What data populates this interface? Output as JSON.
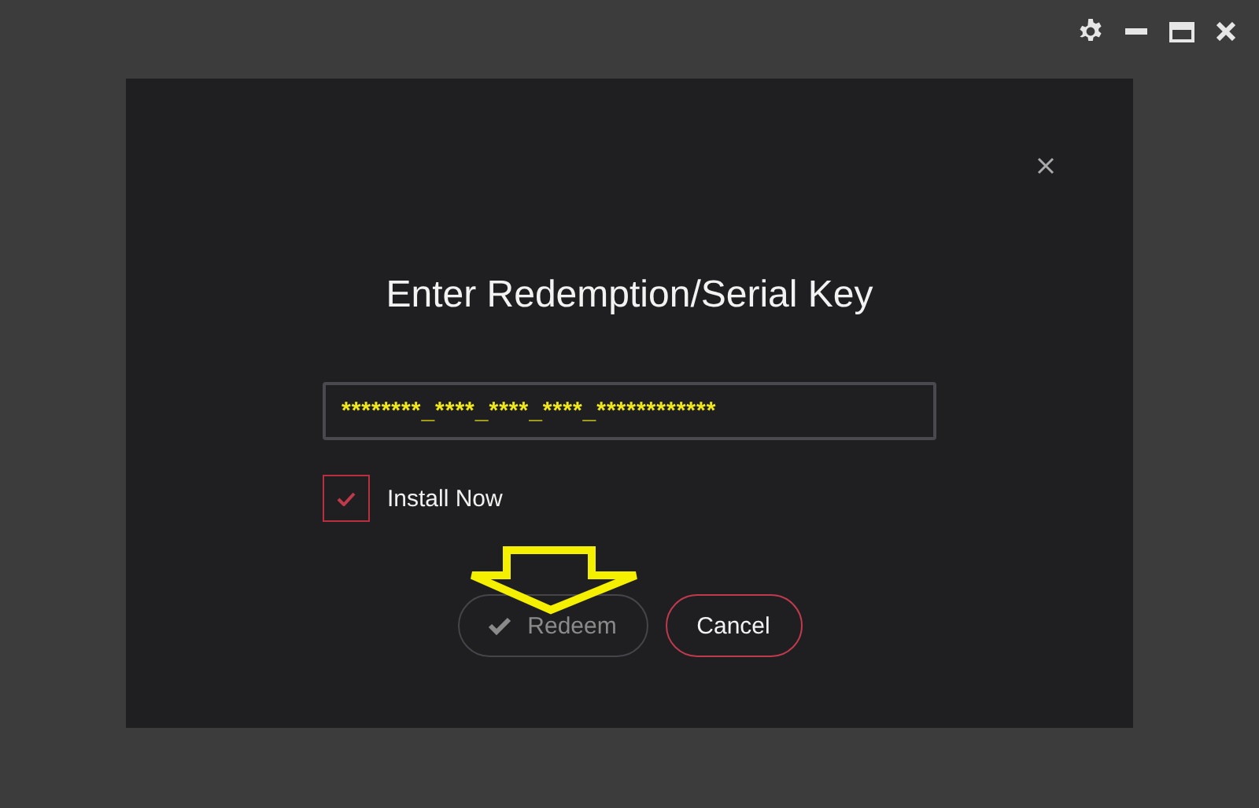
{
  "dialog": {
    "title": "Enter Redemption/Serial Key",
    "key_field": {
      "value": "********_****_****_****_************"
    },
    "install_now": {
      "label": "Install Now",
      "checked": true
    },
    "buttons": [
      {
        "label": "Redeem",
        "kind": "confirm",
        "disabled": true
      },
      {
        "label": "Cancel",
        "kind": "cancel",
        "disabled": false
      }
    ]
  }
}
